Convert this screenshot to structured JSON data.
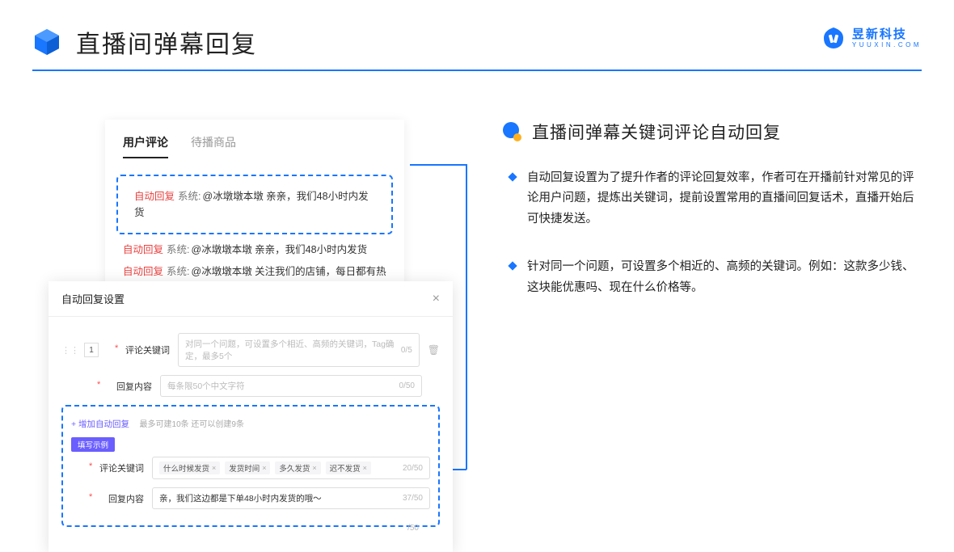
{
  "header": {
    "title": "直播间弹幕回复"
  },
  "brand": {
    "cn": "昱新科技",
    "en": "YUUXIN.COM"
  },
  "commentPanel": {
    "tab_active": "用户评论",
    "tab_inactive": "待播商品",
    "items": [
      {
        "tag": "自动回复",
        "sys": "系统:",
        "msg": "@冰墩墩本墩 亲亲，我们48小时内发货"
      },
      {
        "tag": "自动回复",
        "sys": "系统:",
        "msg": "@冰墩墩本墩 亲亲，我们48小时内发货"
      },
      {
        "tag": "自动回复",
        "sys": "系统:",
        "msg": "@冰墩墩本墩 关注我们的店铺，每日都有热门推荐呦～"
      }
    ]
  },
  "modal": {
    "title": "自动回复设置",
    "row_num": "1",
    "label_keyword": "评论关键词",
    "placeholder_keyword": "对同一个问题，可设置多个相近、高频的关键词，Tag确定，最多5个",
    "count_keyword": "0/5",
    "label_content": "回复内容",
    "placeholder_content": "每条限50个中文字符",
    "count_content": "0/50",
    "count_content2": "/50",
    "add_link": "+ 增加自动回复",
    "add_hint": "最多可建10条 还可以创建9条",
    "example_label": "填写示例",
    "ex_label_keyword": "评论关键词",
    "ex_tags": [
      "什么时候发货",
      "发货时间",
      "多久发货",
      "迟不发货"
    ],
    "ex_count_keyword": "20/50",
    "ex_label_content": "回复内容",
    "ex_content": "亲，我们这边都是下单48小时内发货的哦～",
    "ex_count_content": "37/50"
  },
  "section": {
    "title": "直播间弹幕关键词评论自动回复",
    "bullets": [
      "自动回复设置为了提升作者的评论回复效率，作者可在开播前针对常见的评论用户问题，提炼出关键词，提前设置常用的直播间回复话术，直播开始后可快捷发送。",
      "针对同一个问题，可设置多个相近的、高频的关键词。例如：这款多少钱、这块能优惠吗、现在什么价格等。"
    ]
  }
}
